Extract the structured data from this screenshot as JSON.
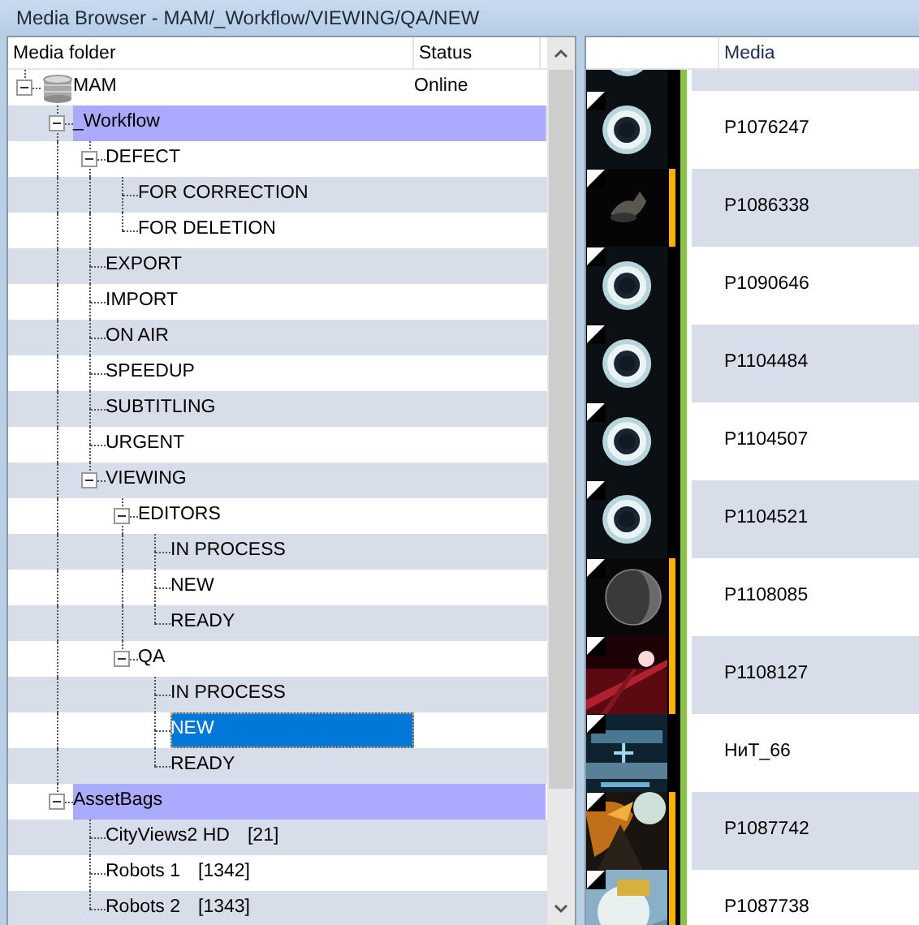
{
  "window": {
    "title": "Media Browser - MAM/_Workflow/VIEWING/QA/NEW"
  },
  "folder_tree": {
    "columns": [
      "Media folder",
      "Status"
    ],
    "items": [
      {
        "label": "MAM",
        "status": "Online",
        "kind": "database",
        "expanded": true,
        "highlighted": false,
        "selected": false,
        "children": [
          {
            "label": "_Workflow",
            "expanded": true,
            "highlighted": true,
            "selected": false,
            "children": [
              {
                "label": "DEFECT",
                "expanded": true,
                "highlighted": false,
                "selected": false,
                "children": [
                  {
                    "label": "FOR CORRECTION",
                    "highlighted": false,
                    "selected": false
                  },
                  {
                    "label": "FOR DELETION",
                    "highlighted": false,
                    "selected": false
                  }
                ]
              },
              {
                "label": "EXPORT",
                "highlighted": false,
                "selected": false
              },
              {
                "label": "IMPORT",
                "highlighted": false,
                "selected": false
              },
              {
                "label": "ON AIR",
                "highlighted": false,
                "selected": false
              },
              {
                "label": "SPEEDUP",
                "highlighted": false,
                "selected": false
              },
              {
                "label": "SUBTITLING",
                "highlighted": false,
                "selected": false
              },
              {
                "label": "URGENT",
                "highlighted": false,
                "selected": false
              },
              {
                "label": "VIEWING",
                "expanded": true,
                "highlighted": false,
                "selected": false,
                "children": [
                  {
                    "label": "EDITORS",
                    "expanded": true,
                    "highlighted": false,
                    "selected": false,
                    "children": [
                      {
                        "label": "IN PROCESS",
                        "highlighted": false,
                        "selected": false
                      },
                      {
                        "label": "NEW",
                        "highlighted": false,
                        "selected": false
                      },
                      {
                        "label": "READY",
                        "highlighted": false,
                        "selected": false
                      }
                    ]
                  },
                  {
                    "label": "QA",
                    "expanded": true,
                    "highlighted": false,
                    "selected": false,
                    "children": [
                      {
                        "label": "IN PROCESS",
                        "highlighted": false,
                        "selected": false
                      },
                      {
                        "label": "NEW",
                        "highlighted": false,
                        "selected": true
                      },
                      {
                        "label": "READY",
                        "highlighted": false,
                        "selected": false
                      }
                    ]
                  }
                ]
              }
            ]
          },
          {
            "label": "AssetBags",
            "expanded": true,
            "highlighted": true,
            "selected": false,
            "children": [
              {
                "label": "CityViews2 HD",
                "count": "[21]",
                "highlighted": false,
                "selected": false
              },
              {
                "label": "Robots 1",
                "count": "[1342]",
                "highlighted": false,
                "selected": false
              },
              {
                "label": "Robots 2",
                "count": "[1343]",
                "highlighted": false,
                "selected": false
              }
            ]
          }
        ]
      }
    ]
  },
  "media_list": {
    "columns": [
      "Media"
    ],
    "items": [
      {
        "kind": "picture",
        "flagged": false
      },
      {
        "name": "P1076247",
        "kind": "picture",
        "flagged": false
      },
      {
        "name": "P1086338",
        "kind": "picture",
        "flagged": true
      },
      {
        "name": "P1090646",
        "kind": "picture",
        "flagged": false
      },
      {
        "name": "P1104484",
        "kind": "picture",
        "flagged": false
      },
      {
        "name": "P1104507",
        "kind": "picture",
        "flagged": false
      },
      {
        "name": "P1104521",
        "kind": "picture",
        "flagged": false
      },
      {
        "name": "P1108085",
        "kind": "picture",
        "flagged": true
      },
      {
        "name": "P1108127",
        "kind": "picture",
        "flagged": true
      },
      {
        "name": "НиТ_66",
        "kind": "picture",
        "flagged": false
      },
      {
        "name": "P1087742",
        "kind": "picture",
        "flagged": true
      },
      {
        "name": "P1087738",
        "kind": "picture",
        "flagged": true
      }
    ]
  }
}
